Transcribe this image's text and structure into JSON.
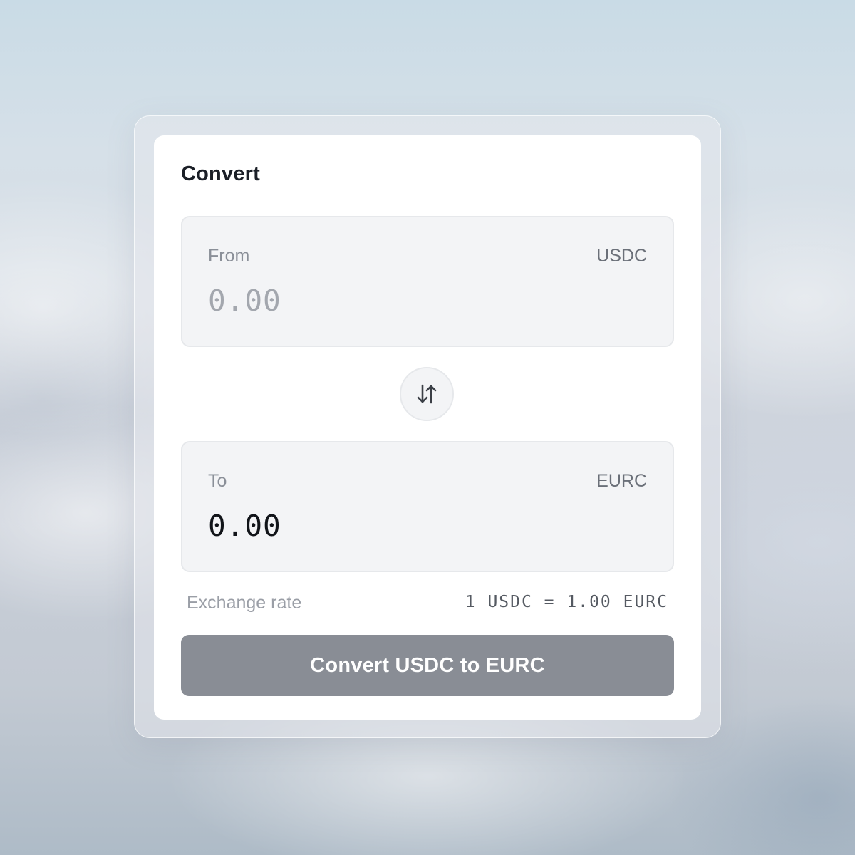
{
  "converter": {
    "title": "Convert",
    "from": {
      "label": "From",
      "currency": "USDC",
      "amount_placeholder": "0.00"
    },
    "to": {
      "label": "To",
      "currency": "EURC",
      "amount": "0.00"
    },
    "swap_icon": "swap-vertical-arrows-icon",
    "exchange_rate": {
      "label": "Exchange rate",
      "value": "1 USDC = 1.00 EURC"
    },
    "submit_label": "Convert USDC to EURC"
  },
  "colors": {
    "panel_bg": "#ffffff",
    "field_bg": "#f3f4f6",
    "button_bg": "#898d95",
    "title_text": "#1b1f27"
  }
}
